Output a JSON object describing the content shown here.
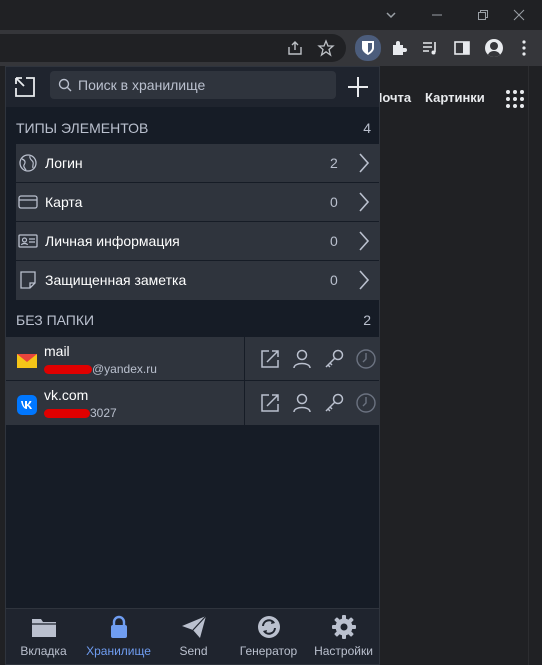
{
  "browser": {
    "window_buttons": [
      "chevron-down",
      "minimize",
      "restore",
      "close"
    ]
  },
  "page": {
    "links": [
      "Почта",
      "Картинки"
    ]
  },
  "popup": {
    "search_placeholder": "Поиск в хранилище",
    "types_section": {
      "title": "ТИПЫ ЭЛЕМЕНТОВ",
      "count": "4"
    },
    "types": [
      {
        "icon": "globe-icon",
        "label": "Логин",
        "count": "2"
      },
      {
        "icon": "credit-card-icon",
        "label": "Карта",
        "count": "0"
      },
      {
        "icon": "id-card-icon",
        "label": "Личная информация",
        "count": "0"
      },
      {
        "icon": "note-icon",
        "label": "Защищенная заметка",
        "count": "0"
      }
    ],
    "folder_section": {
      "title": "БЕЗ ПАПКИ",
      "count": "2"
    },
    "items": [
      {
        "icon": "yandex-mail-icon",
        "name": "mail",
        "subtitle_tail": "@yandex.ru"
      },
      {
        "icon": "vk-icon",
        "name": "vk.com",
        "subtitle_tail": "3027"
      }
    ],
    "nav": [
      {
        "icon": "folder-icon",
        "label": "Вкладка",
        "active": false
      },
      {
        "icon": "lock-icon",
        "label": "Хранилище",
        "active": true
      },
      {
        "icon": "send-icon",
        "label": "Send",
        "active": false
      },
      {
        "icon": "generator-icon",
        "label": "Генератор",
        "active": false
      },
      {
        "icon": "gear-icon",
        "label": "Настройки",
        "active": false
      }
    ]
  },
  "colors": {
    "popup_bg": "#161c26",
    "row_bg": "#2f343d",
    "accent": "#6f9df1",
    "redaction": "#e00000"
  }
}
